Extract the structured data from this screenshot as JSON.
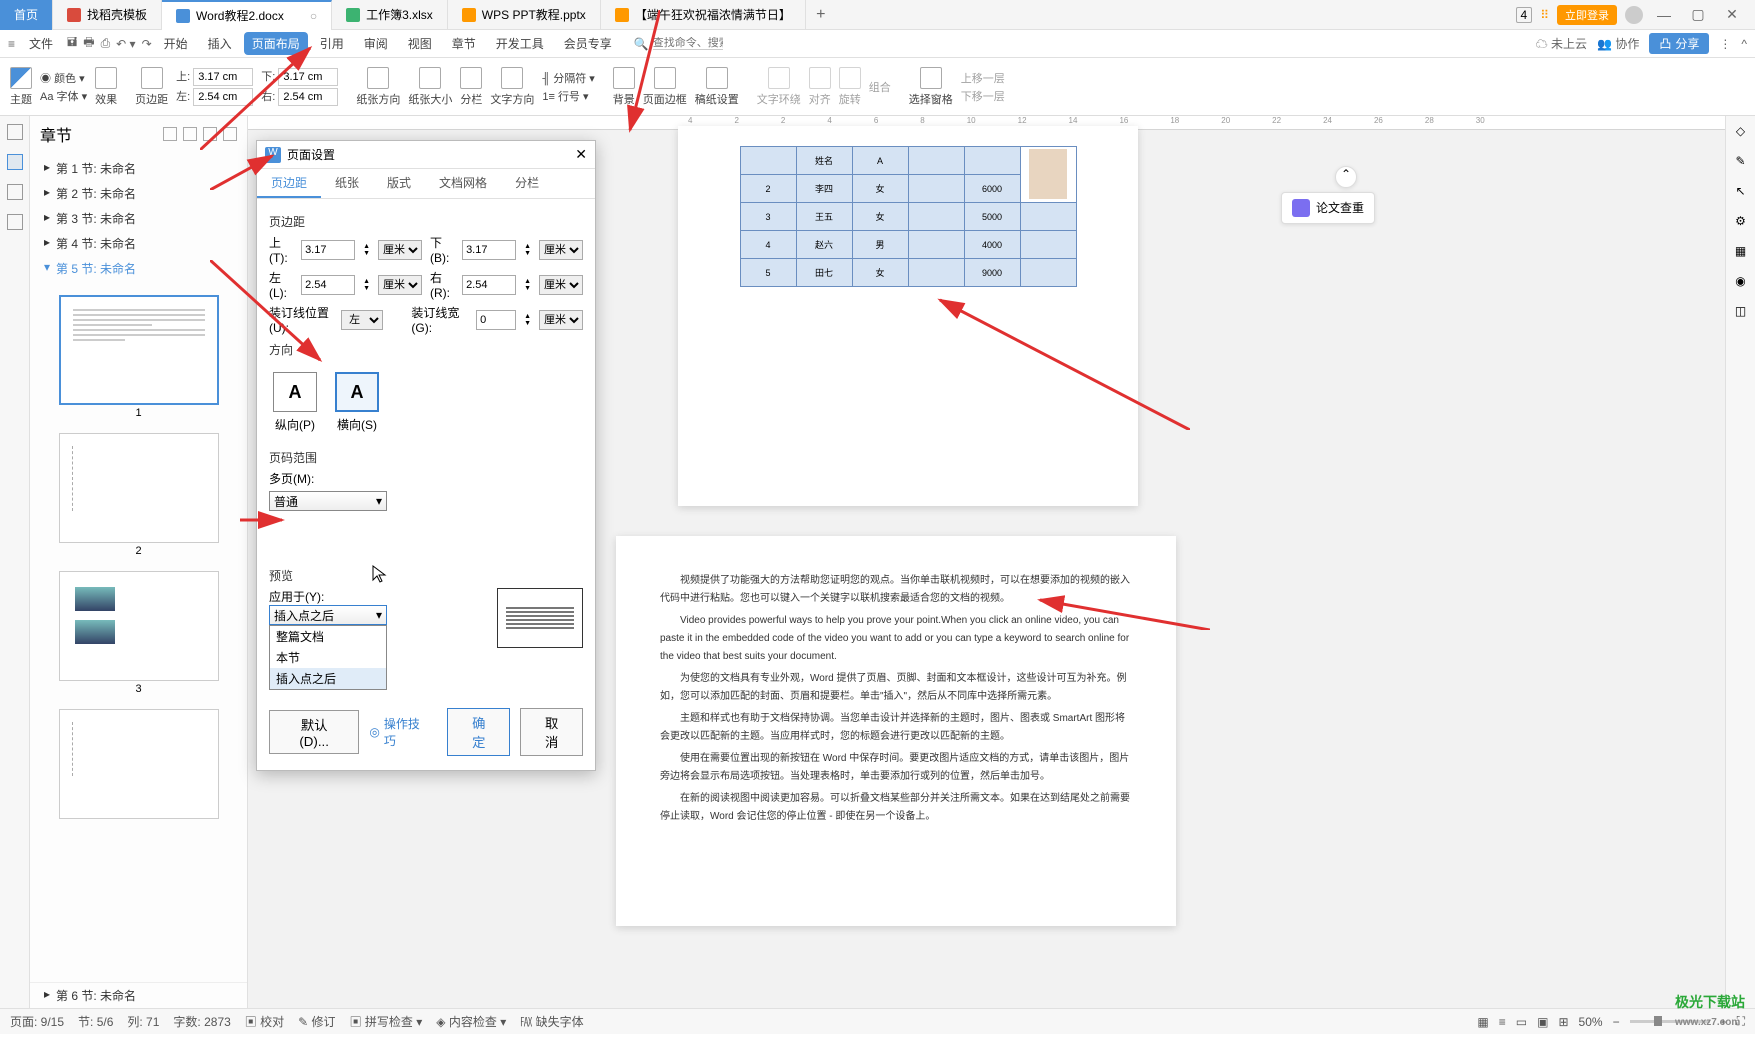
{
  "tabs": {
    "home": "首页",
    "items": [
      {
        "label": "找稻壳模板",
        "icon_color": "#d94b3d"
      },
      {
        "label": "Word教程2.docx",
        "icon_color": "#4a90d9",
        "active": true
      },
      {
        "label": "工作簿3.xlsx",
        "icon_color": "#3cb371"
      },
      {
        "label": "WPS PPT教程.pptx",
        "icon_color": "#ff9900"
      },
      {
        "label": "【端午狂欢祝福浓情满节日】",
        "icon_color": "#ff9900"
      }
    ]
  },
  "titlebar_right": {
    "login": "立即登录",
    "badge": "4"
  },
  "menubar": {
    "file": "文件",
    "items": [
      "开始",
      "插入",
      "页面布局",
      "引用",
      "审阅",
      "视图",
      "章节",
      "开发工具",
      "会员专享"
    ],
    "active_index": 2,
    "search_placeholder": "查找命令、搜索模板",
    "right": {
      "cloud": "未上云",
      "coop": "协作",
      "share": "分享"
    }
  },
  "ribbon": {
    "theme": "主题",
    "font": "字体",
    "color": "颜色",
    "effect": "效果",
    "margins": "页边距",
    "top": "上:",
    "top_val": "3.17 cm",
    "left": "左:",
    "left_val": "2.54 cm",
    "btop": "下:",
    "btop_val": "3.17 cm",
    "bleft": "右:",
    "bleft_val": "2.54 cm",
    "orient": "纸张方向",
    "size": "纸张大小",
    "columns": "分栏",
    "textdir": "文字方向",
    "linenum": "行号",
    "breaks_label": "分隔符",
    "background": "背景",
    "border": "页面边框",
    "writing": "稿纸设置",
    "wrap": "文字环绕",
    "align": "对齐",
    "rotate": "旋转",
    "combine": "组合",
    "pane": "选择窗格",
    "moveup": "上移一层",
    "movedown": "下移一层"
  },
  "sidebar": {
    "title": "章节",
    "sections": [
      "第 1 节: 未命名",
      "第 2 节: 未命名",
      "第 3 节: 未命名",
      "第 4 节: 未命名",
      "第 5 节: 未命名"
    ],
    "section6": "第 6 节: 未命名",
    "thumb_nums": [
      "1",
      "2",
      "3"
    ]
  },
  "dialog": {
    "title": "页面设置",
    "tabs": [
      "页边距",
      "纸张",
      "版式",
      "文档网格",
      "分栏"
    ],
    "section_margin": "页边距",
    "top": "上(T):",
    "top_val": "3.17",
    "bottom": "下(B):",
    "bottom_val": "3.17",
    "left": "左(L):",
    "left_val": "2.54",
    "right": "右(R):",
    "right_val": "2.54",
    "gutter_pos": "装订线位置(U):",
    "gutter_pos_val": "左",
    "gutter_w": "装订线宽(G):",
    "gutter_w_val": "0",
    "unit": "厘米",
    "orient_title": "方向",
    "portrait": "纵向(P)",
    "landscape": "横向(S)",
    "range_title": "页码范围",
    "multipage": "多页(M):",
    "multipage_val": "普通",
    "preview": "预览",
    "apply": "应用于(Y):",
    "apply_val": "插入点之后",
    "apply_options": [
      "整篇文档",
      "本节",
      "插入点之后"
    ],
    "default": "默认(D)...",
    "tip": "操作技巧",
    "ok": "确定",
    "cancel": "取消"
  },
  "page1_table": {
    "rows": [
      [
        "",
        "姓名",
        "A",
        "",
        "",
        ""
      ],
      [
        "2",
        "李四",
        "女",
        "",
        "6000",
        ""
      ],
      [
        "3",
        "王五",
        "女",
        "",
        "5000",
        ""
      ],
      [
        "4",
        "赵六",
        "男",
        "",
        "4000",
        ""
      ],
      [
        "5",
        "田七",
        "女",
        "",
        "9000",
        ""
      ]
    ]
  },
  "page2_text": [
    "视频提供了功能强大的方法帮助您证明您的观点。当你单击联机视频时，可以在想要添加的视频的嵌入代码中进行粘贴。您也可以键入一个关键字以联机搜索最适合您的文档的视频。",
    "Video provides powerful ways to help you prove your point.When you click an online video, you can paste it in the embedded code of the video you want to add or you can type a keyword to search online for the video that best suits your document.",
    "为使您的文档具有专业外观，Word 提供了页眉、页脚、封面和文本框设计，这些设计可互为补充。例如，您可以添加匹配的封面、页眉和提要栏。单击\"插入\"，然后从不同库中选择所需元素。",
    "主题和样式也有助于文档保持协调。当您单击设计并选择新的主题时，图片、图表或 SmartArt 图形将会更改以匹配新的主题。当应用样式时，您的标题会进行更改以匹配新的主题。",
    "使用在需要位置出现的新按钮在 Word 中保存时间。要更改图片适应文档的方式，请单击该图片，图片旁边将会显示布局选项按钮。当处理表格时，单击要添加行或列的位置，然后单击加号。",
    "在新的阅读视图中阅读更加容易。可以折叠文档某些部分并关注所需文本。如果在达到结尾处之前需要停止读取，Word 会记住您的停止位置 - 即使在另一个设备上。"
  ],
  "float": {
    "label": "论文查重"
  },
  "status": {
    "page": "页面: 9/15",
    "section": "节: 5/6",
    "col": "列: 71",
    "words": "字数: 2873",
    "check": "校对",
    "revise": "修订",
    "spell": "拼写检查",
    "content": "内容检查",
    "missing": "缺失字体",
    "zoom": "50%"
  },
  "watermark": "极光下载站",
  "watermark_url": "www.xz7.com"
}
